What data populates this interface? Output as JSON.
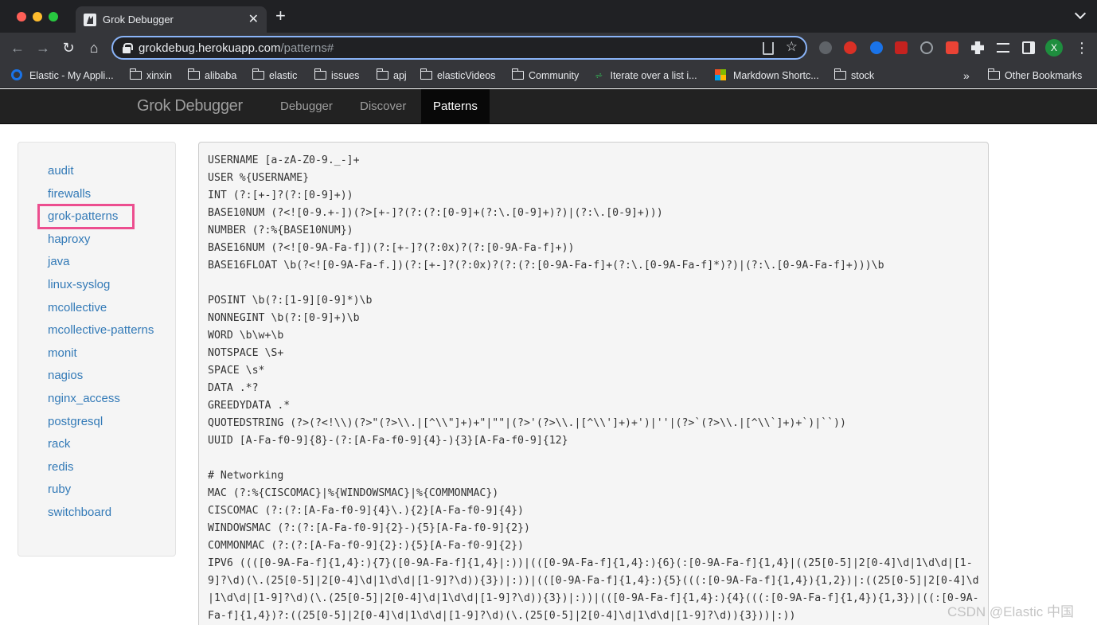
{
  "browser": {
    "tab_title": "Grok Debugger",
    "url_host": "grokdebug.herokuapp.com",
    "url_path": "/patterns#",
    "profile_initial": "X",
    "bookmarks": [
      {
        "label": "Elastic - My Appli...",
        "icon": "elastic-icon"
      },
      {
        "label": "xinxin",
        "icon": "folder-icon"
      },
      {
        "label": "alibaba",
        "icon": "folder-icon"
      },
      {
        "label": "elastic",
        "icon": "folder-icon"
      },
      {
        "label": "issues",
        "icon": "folder-icon"
      },
      {
        "label": "apj",
        "icon": "folder-icon"
      },
      {
        "label": "elasticVideos",
        "icon": "folder-icon"
      },
      {
        "label": "Community",
        "icon": "folder-icon"
      },
      {
        "label": "Iterate over a list i...",
        "icon": "link-icon"
      },
      {
        "label": "Markdown Shortc...",
        "icon": "microsoft-icon"
      },
      {
        "label": "stock",
        "icon": "folder-icon"
      }
    ],
    "bookmarks_more": "»",
    "other_bookmarks": "Other Bookmarks"
  },
  "app": {
    "brand": "Grok Debugger",
    "nav": [
      "Debugger",
      "Discover",
      "Patterns"
    ],
    "active_nav": "Patterns"
  },
  "sidebar": {
    "items": [
      "audit",
      "firewalls",
      "grok-patterns",
      "haproxy",
      "java",
      "linux-syslog",
      "mcollective",
      "mcollective-patterns",
      "monit",
      "nagios",
      "nginx_access",
      "postgresql",
      "rack",
      "redis",
      "ruby",
      "switchboard"
    ],
    "selected": "grok-patterns",
    "highlight_color": "#ec4e8f"
  },
  "patterns_text": "USERNAME [a-zA-Z0-9._-]+\nUSER %{USERNAME}\nINT (?:[+-]?(?:[0-9]+))\nBASE10NUM (?<![0-9.+-])(?>[+-]?(?:(?:[0-9]+(?:\\.[0-9]+)?)|(?:\\.[0-9]+)))\nNUMBER (?:%{BASE10NUM})\nBASE16NUM (?<![0-9A-Fa-f])(?:[+-]?(?:0x)?(?:[0-9A-Fa-f]+))\nBASE16FLOAT \\b(?<![0-9A-Fa-f.])(?:[+-]?(?:0x)?(?:(?:[0-9A-Fa-f]+(?:\\.[0-9A-Fa-f]*)?)|(?:\\.[0-9A-Fa-f]+)))\\b\n\nPOSINT \\b(?:[1-9][0-9]*)\\b\nNONNEGINT \\b(?:[0-9]+)\\b\nWORD \\b\\w+\\b\nNOTSPACE \\S+\nSPACE \\s*\nDATA .*?\nGREEDYDATA .*\nQUOTEDSTRING (?>(?<!\\\\)(?>\"(?>\\\\.|[^\\\\\"]+)+\"|\"\"|(?>'(?>\\\\.|[^\\\\']+)+')|''|(?>`(?>\\\\.|[^\\\\`]+)+`)|``))\nUUID [A-Fa-f0-9]{8}-(?:[A-Fa-f0-9]{4}-){3}[A-Fa-f0-9]{12}\n\n# Networking\nMAC (?:%{CISCOMAC}|%{WINDOWSMAC}|%{COMMONMAC})\nCISCOMAC (?:(?:[A-Fa-f0-9]{4}\\.){2}[A-Fa-f0-9]{4})\nWINDOWSMAC (?:(?:[A-Fa-f0-9]{2}-){5}[A-Fa-f0-9]{2})\nCOMMONMAC (?:(?:[A-Fa-f0-9]{2}:){5}[A-Fa-f0-9]{2})\nIPV6 ((([0-9A-Fa-f]{1,4}:){7}([0-9A-Fa-f]{1,4}|:))|(([0-9A-Fa-f]{1,4}:){6}(:[0-9A-Fa-f]{1,4}|((25[0-5]|2[0-4]\\d|1\\d\\d|[1-9]?\\d)(\\.(25[0-5]|2[0-4]\\d|1\\d\\d|[1-9]?\\d)){3})|:))|(([0-9A-Fa-f]{1,4}:){5}(((:[0-9A-Fa-f]{1,4}){1,2})|:((25[0-5]|2[0-4]\\d|1\\d\\d|[1-9]?\\d)(\\.(25[0-5]|2[0-4]\\d|1\\d\\d|[1-9]?\\d)){3})|:))|(([0-9A-Fa-f]{1,4}:){4}(((:[0-9A-Fa-f]{1,4}){1,3})|((:[0-9A-Fa-f]{1,4})?:((25[0-5]|2[0-4]\\d|1\\d\\d|[1-9]?\\d)(\\.(25[0-5]|2[0-4]\\d|1\\d\\d|[1-9]?\\d)){3}))|:))",
  "watermark": "CSDN @Elastic 中国"
}
